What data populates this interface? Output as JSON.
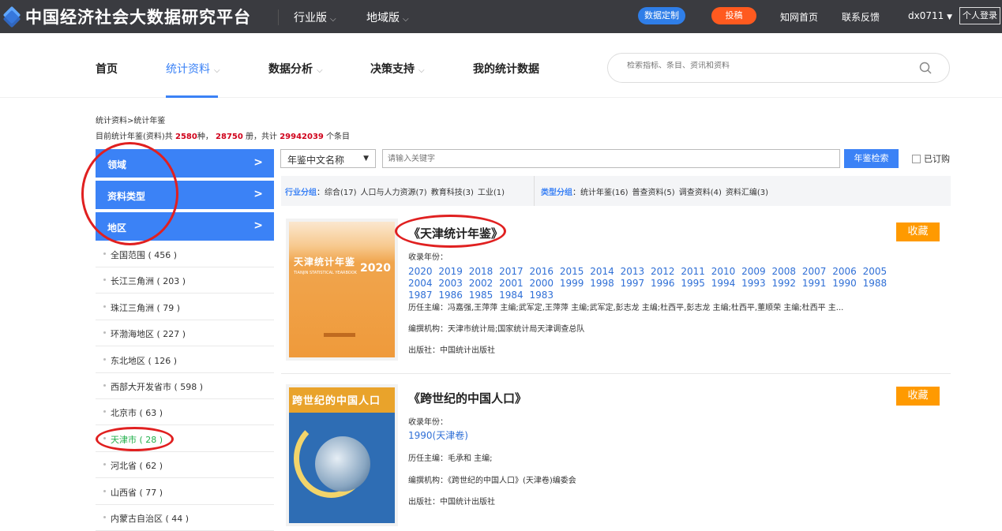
{
  "topbar": {
    "logo_text": "中国经济社会大数据研究平台",
    "dropdowns": [
      "行业版",
      "地域版"
    ],
    "btn_custom": "数据定制",
    "btn_submit": "投稿",
    "link_home": "知网首页",
    "link_feedback": "联系反馈",
    "user": "dx0711",
    "login": "个人登录",
    "colors": {
      "bg": "#3a3b40",
      "custom": "#2f7ee8",
      "submit": "#ff5a1f"
    }
  },
  "nav": {
    "items": [
      {
        "label": "首页"
      },
      {
        "label": "统计资料"
      },
      {
        "label": "数据分析"
      },
      {
        "label": "决策支持"
      },
      {
        "label": "我的统计数据"
      }
    ],
    "search_placeholder": "检索指标、条目、资讯和资料"
  },
  "breadcrumb": "统计资料>统计年鉴",
  "stats": {
    "prefix": "目前统计年鉴(资料)共",
    "kinds": "2580",
    "kinds_unit": "种，",
    "volumes": "28750",
    "volumes_unit": "册，共计",
    "entries": "29942039",
    "entries_unit": "个条目"
  },
  "sidebar": {
    "heads": [
      {
        "label": "领域"
      },
      {
        "label": "资料类型"
      },
      {
        "label": "地区"
      }
    ],
    "regions": [
      "全国范围 ( 456 )",
      "长江三角洲 ( 203 )",
      "珠江三角洲 ( 79 )",
      "环渤海地区 ( 227 )",
      "东北地区 ( 126 )",
      "西部大开发省市 ( 598 )",
      "北京市 ( 63 )",
      "天津市 ( 28 )",
      "河北省 ( 62 )",
      "山西省 ( 77 )",
      "内蒙古自治区 ( 44 )"
    ],
    "selected_index": 7
  },
  "search": {
    "select_value": "年鉴中文名称",
    "keyword_placeholder": "请输入关键字",
    "btn": "年鉴检索",
    "subscribed": "已订购"
  },
  "filter": {
    "industry_label": "行业分组",
    "industry_items": [
      "综合(17)",
      "人口与人力资源(7)",
      "教育科技(3)",
      "工业(1)"
    ],
    "type_label": "类型分组",
    "type_items": [
      "统计年鉴(16)",
      "普查资料(5)",
      "调查资料(4)",
      "资料汇编(3)"
    ]
  },
  "results": [
    {
      "title": "《天津统计年鉴》",
      "fav": "收藏",
      "years_label": "收录年份：",
      "years": [
        "2020",
        "2019",
        "2018",
        "2017",
        "2016",
        "2015",
        "2014",
        "2013",
        "2012",
        "2011",
        "2010",
        "2009",
        "2008",
        "2007",
        "2006",
        "2005",
        "2004",
        "2003",
        "2002",
        "2001",
        "2000",
        "1999",
        "1998",
        "1997",
        "1996",
        "1995",
        "1994",
        "1993",
        "1992",
        "1991",
        "1990",
        "1988",
        "1987",
        "1986",
        "1985",
        "1984",
        "1983"
      ],
      "editors": "历任主编：冯嘉强,王萍萍 主编;武军定,王萍萍 主编;武军定,彭志龙 主编;杜西平,彭志龙 主编;杜西平,董顺荣 主编;杜西平 主...",
      "org": "编撰机构：天津市统计局;国家统计局天津调查总队",
      "publisher": "出版社：中国统计出版社",
      "cover": {
        "title": "天津统计年鉴",
        "year": "2020",
        "subtitle": "TIANJIN STATISTICAL YEARBOOK"
      }
    },
    {
      "title": "《跨世纪的中国人口》",
      "fav": "收藏",
      "years_label": "收录年份：",
      "years": [
        "1990(天津卷)"
      ],
      "editors": "历任主编：毛承和 主编;",
      "org": "编撰机构：《跨世纪的中国人口》(天津卷)编委会",
      "publisher": "出版社：中国统计出版社",
      "cover": {
        "title": "跨世纪的中国人口"
      }
    }
  ]
}
